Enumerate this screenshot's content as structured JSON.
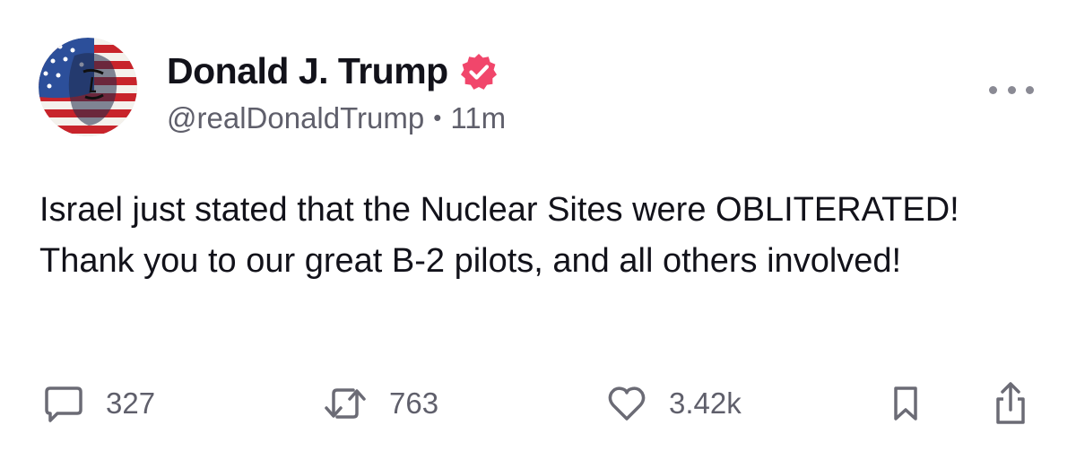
{
  "author": {
    "display_name": "Donald J. Trump",
    "handle": "@realDonaldTrump",
    "separator": "•",
    "timestamp": "11m",
    "verified": true
  },
  "post": {
    "text": "Israel just stated that the Nuclear Sites were OBLITERATED! Thank you to our great B-2 pilots, and all others involved!"
  },
  "actions": {
    "replies": "327",
    "reposts": "763",
    "likes": "3.42k"
  },
  "icons": {
    "avatar": "american-flag-portrait-avatar",
    "verified": "verified-badge-icon",
    "more": "more-options-icon",
    "reply": "reply-bubble-icon",
    "repost": "repost-icon",
    "like": "heart-icon",
    "bookmark": "bookmark-icon",
    "share": "share-icon"
  },
  "colors": {
    "verified_badge": "#f1466b",
    "text_primary": "#12121a",
    "text_secondary": "#5f5f6b",
    "icon": "#6b6b75"
  }
}
